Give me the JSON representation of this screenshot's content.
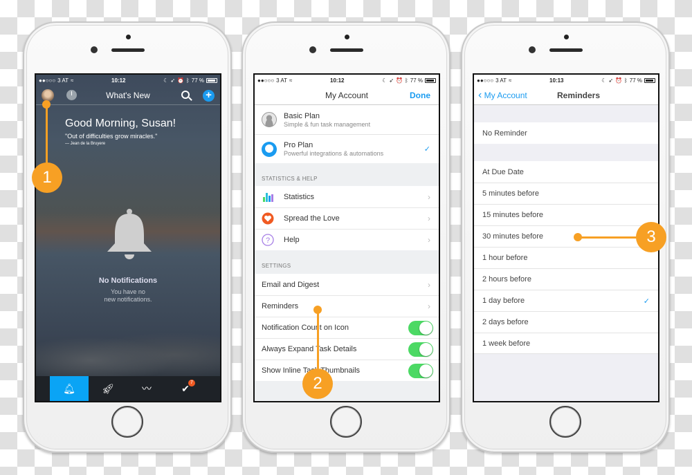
{
  "status": {
    "carrier": "3 AT",
    "battery": "77 %",
    "time_phone1": "10:12",
    "time_phone2": "10:12",
    "time_phone3": "10:13"
  },
  "phone1": {
    "nav_title": "What's New",
    "greeting": "Good Morning, Susan!",
    "quote": "\"Out of difficulties grow miracles.\"",
    "author": "— Jean de la Bruyere",
    "empty_title": "No Notifications",
    "empty_sub_line1": "You have no",
    "empty_sub_line2": "new notifications.",
    "tabs": [
      {
        "icon": "bell-icon",
        "active": true
      },
      {
        "icon": "rocket-icon",
        "active": false
      },
      {
        "icon": "activity-chart-icon",
        "active": false
      },
      {
        "icon": "tasks-check-icon",
        "active": false,
        "badge": "7"
      }
    ]
  },
  "phone2": {
    "nav_title": "My Account",
    "done_label": "Done",
    "plans": [
      {
        "name": "Basic Plan",
        "desc": "Simple & fun task management",
        "selected": false
      },
      {
        "name": "Pro Plan",
        "desc": "Powerful integrations & automations",
        "selected": true
      }
    ],
    "stats_header": "STATISTICS & HELP",
    "stats_items": [
      "Statistics",
      "Spread the Love",
      "Help"
    ],
    "settings_header": "SETTINGS",
    "settings_links": [
      "Email and Digest",
      "Reminders"
    ],
    "settings_toggles": [
      {
        "label": "Notification Count on Icon",
        "on": true
      },
      {
        "label": "Always Expand Task Details",
        "on": true
      },
      {
        "label": "Show Inline Task Thumbnails",
        "on": true
      }
    ]
  },
  "phone3": {
    "back_label": "My Account",
    "nav_title": "Reminders",
    "no_reminder": "No Reminder",
    "options": [
      "At Due Date",
      "5 minutes before",
      "15 minutes before",
      "30 minutes before",
      "1 hour before",
      "2 hours before",
      "1 day before",
      "2 days before",
      "1 week before"
    ],
    "selected": "1 day before"
  },
  "callouts": [
    "1",
    "2",
    "3"
  ],
  "colors": {
    "accent_blue": "#1a9bf0",
    "callout_orange": "#f7a024",
    "toggle_green": "#4cd964",
    "active_tab": "#0aa4f5"
  }
}
